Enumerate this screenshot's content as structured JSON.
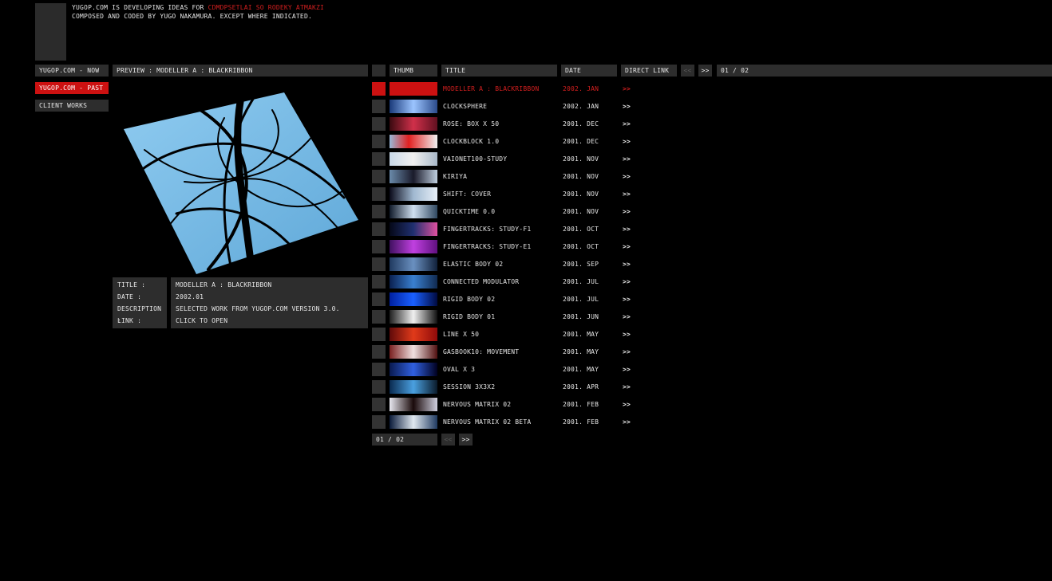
{
  "header": {
    "line1_prefix": "YUGOP.COM IS DEVELOPING IDEAS FOR ",
    "line1_highlight": "CDMDPSETLAI SO RODEKY ATMAKZI",
    "line2": "COMPOSED AND CODED BY YUGO NAKAMURA. EXCEPT WHERE INDICATED."
  },
  "nav": [
    {
      "label": "YUGOP.COM - NOW"
    },
    {
      "label": "YUGOP.COM - PAST"
    },
    {
      "label": "CLIENT WORKS"
    }
  ],
  "preview": {
    "header": "PREVIEW : MODELLER A : BLACKRIBBON",
    "labels": {
      "title": "TITLE :",
      "date": "DATE :",
      "description": "DESCRIPTION :",
      "link": "LINK :"
    },
    "values": {
      "title": "MODELLER A : BLACKRIBBON",
      "date": "2002.01",
      "description": "SELECTED WORK FROM YUGOP.COM VERSION 3.0.",
      "link": "CLICK TO OPEN"
    }
  },
  "list": {
    "headers": {
      "thumb": "THUMB",
      "title": "TITLE",
      "date": "DATE",
      "link": "DIRECT LINK"
    },
    "pager": {
      "prev": "<<",
      "next": ">>",
      "page": "01 / 02"
    },
    "items": [
      {
        "title": "MODELLER A : BLACKRIBBON",
        "date": "2002. JAN",
        "link": ">>"
      },
      {
        "title": "CLOCKSPHERE",
        "date": "2002. JAN",
        "link": ">>"
      },
      {
        "title": "ROSE: BOX X 50",
        "date": "2001. DEC",
        "link": ">>"
      },
      {
        "title": "CLOCKBLOCK 1.0",
        "date": "2001. DEC",
        "link": ">>"
      },
      {
        "title": "VAIONET100-STUDY",
        "date": "2001. NOV",
        "link": ">>"
      },
      {
        "title": "KIRIYA",
        "date": "2001. NOV",
        "link": ">>"
      },
      {
        "title": "SHIFT: COVER",
        "date": "2001. NOV",
        "link": ">>"
      },
      {
        "title": "QUICKTIME 0.0",
        "date": "2001. NOV",
        "link": ">>"
      },
      {
        "title": "FINGERTRACKS: STUDY-F1",
        "date": "2001. OCT",
        "link": ">>"
      },
      {
        "title": "FINGERTRACKS: STUDY-E1",
        "date": "2001. OCT",
        "link": ">>"
      },
      {
        "title": "ELASTIC BODY 02",
        "date": "2001. SEP",
        "link": ">>"
      },
      {
        "title": "CONNECTED MODULATOR",
        "date": "2001. JUL",
        "link": ">>"
      },
      {
        "title": "RIGID BODY 02",
        "date": "2001. JUL",
        "link": ">>"
      },
      {
        "title": "RIGID BODY 01",
        "date": "2001. JUN",
        "link": ">>"
      },
      {
        "title": "LINE X 50",
        "date": "2001. MAY",
        "link": ">>"
      },
      {
        "title": "GASBOOK10: MOVEMENT",
        "date": "2001. MAY",
        "link": ">>"
      },
      {
        "title": "OVAL X 3",
        "date": "2001. MAY",
        "link": ">>"
      },
      {
        "title": "SESSION 3X3X2",
        "date": "2001. APR",
        "link": ">>"
      },
      {
        "title": "NERVOUS MATRIX 02",
        "date": "2001. FEB",
        "link": ">>"
      },
      {
        "title": "NERVOUS MATRIX 02 BETA",
        "date": "2001. FEB",
        "link": ">>"
      }
    ]
  },
  "colors": {
    "accent": "#cc1111",
    "panel": "#2d2d2d",
    "background": "#000000"
  }
}
